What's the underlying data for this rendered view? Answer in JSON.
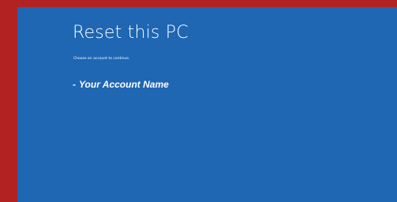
{
  "colors": {
    "frame": "#b22222",
    "panel": "#1f66b3",
    "text": "#ffffff"
  },
  "screen": {
    "title": "Reset this PC",
    "subtitle": "Choose an account to continue."
  },
  "accounts": [
    {
      "bullet": "-",
      "name": "Your Account Name"
    }
  ]
}
